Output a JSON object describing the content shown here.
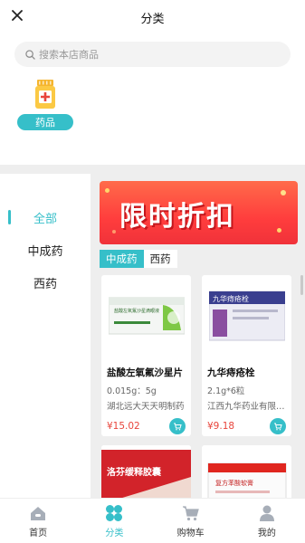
{
  "header": {
    "title": "分类",
    "close_icon": "close-icon"
  },
  "search": {
    "placeholder": "搜索本店商品"
  },
  "top_category": {
    "label": "药品",
    "icon": "medicine-bottle-icon"
  },
  "sidebar": {
    "items": [
      {
        "label": "全部",
        "active": true
      },
      {
        "label": "中成药",
        "active": false
      },
      {
        "label": "西药",
        "active": false
      }
    ]
  },
  "banner": {
    "text": "限时折扣"
  },
  "tabs": [
    {
      "label": "中成药",
      "active": true
    },
    {
      "label": "西药",
      "active": false
    }
  ],
  "products": [
    {
      "name": "盐酸左氧氟沙星片",
      "spec": "0.015g：5g",
      "maker": "湖北远大天天明制药",
      "price": "¥15.02"
    },
    {
      "name": "九华痔疮栓",
      "spec": "2.1g*6粒",
      "maker": "江西九华药业有限公司",
      "price": "¥9.18"
    },
    {
      "name": "",
      "spec": "",
      "maker": "",
      "price": ""
    },
    {
      "name": "",
      "spec": "",
      "maker": "",
      "price": ""
    }
  ],
  "product_images": [
    {
      "box_text": "盐酸左氧氟沙星滴眼液"
    },
    {
      "box_text": "九华痔疮栓"
    },
    {
      "box_text": "洛芬缓释胶囊"
    },
    {
      "box_text": "复方苯酸软膏"
    }
  ],
  "tabbar": {
    "items": [
      {
        "label": "首页",
        "icon": "home-icon",
        "active": false
      },
      {
        "label": "分类",
        "icon": "category-icon",
        "active": true
      },
      {
        "label": "购物车",
        "icon": "cart-icon",
        "active": false
      },
      {
        "label": "我的",
        "icon": "user-icon",
        "active": false
      }
    ]
  },
  "colors": {
    "accent": "#36bfc9",
    "price": "#e8453c",
    "banner": "#ff3d3d"
  }
}
